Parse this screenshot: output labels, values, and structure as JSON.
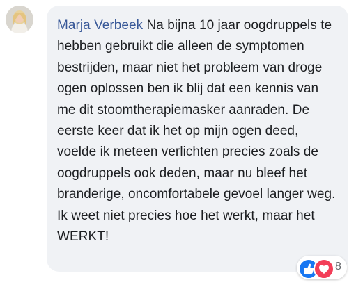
{
  "comment": {
    "author": "Marja Verbeek",
    "body": "Na bijna 10 jaar oogdruppels te hebben gebruikt die alleen de symptomen bestrijden, maar niet het probleem van droge ogen oplossen ben ik blij dat een kennis van me dit stoomtherapiemasker aanraden. De eerste keer dat ik het op mijn ogen deed, voelde ik meteen verlichten precies zoals de oogdruppels ook deden, maar nu bleef het branderige, oncomfortabele gevoel langer weg. Ik weet niet precies hoe het werkt, maar het WERKT!"
  },
  "reactions": {
    "icons": [
      "like-icon",
      "love-icon"
    ],
    "count": "8",
    "colors": {
      "like": "#1877f2",
      "love": "#f33e58"
    }
  },
  "colors": {
    "author": "#385898",
    "bubble": "#f0f2f5",
    "text": "#1c1e21"
  }
}
